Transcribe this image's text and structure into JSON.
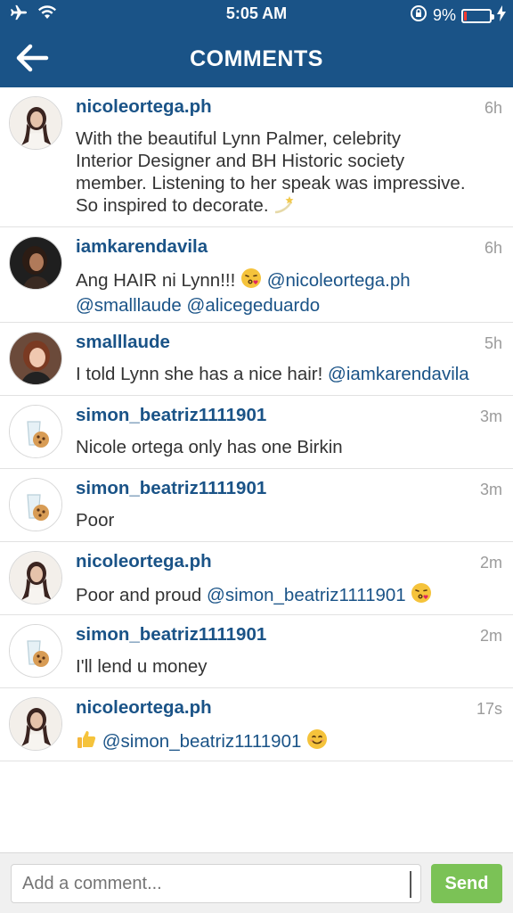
{
  "status_bar": {
    "time": "5:05 AM",
    "battery_percent": "9%",
    "battery_level": 0.09
  },
  "header": {
    "title": "COMMENTS",
    "back_icon": "arrow-left-icon"
  },
  "comments": [
    {
      "user": "nicoleortega.ph",
      "time": "6h",
      "text_lines": [
        "With the beautiful Lynn Palmer, celebrity",
        "Interior Designer and BH Historic society",
        "member. Listening to her speak was impressive.",
        "So inspired to decorate."
      ]
    },
    {
      "user": "iamkarendavila",
      "time": "6h",
      "text_pre": "Ang HAIR ni Lynn!!!",
      "mention1": "@nicoleortega.ph",
      "mention2": "@smalllaude",
      "mention3": "@alicegeduardo"
    },
    {
      "user": "smalllaude",
      "time": "5h",
      "text_pre": "I told Lynn she has a nice hair!",
      "mention1": "@iamkarendavila"
    },
    {
      "user": "simon_beatriz1111901",
      "time": "3m",
      "text": "Nicole ortega only has one Birkin"
    },
    {
      "user": "simon_beatriz1111901",
      "time": "3m",
      "text": "Poor"
    },
    {
      "user": "nicoleortega.ph",
      "time": "2m",
      "text_pre": "Poor and proud",
      "mention1": "@simon_beatriz1111901"
    },
    {
      "user": "simon_beatriz1111901",
      "time": "2m",
      "text": "I'll lend u money"
    },
    {
      "user": "nicoleortega.ph",
      "time": "17s",
      "mention1": "@simon_beatriz1111901"
    }
  ],
  "composer": {
    "placeholder": "Add a comment...",
    "send_label": "Send"
  },
  "colors": {
    "header_bg": "#1a5387",
    "username": "#1a5387",
    "send_button": "#7bc256"
  }
}
